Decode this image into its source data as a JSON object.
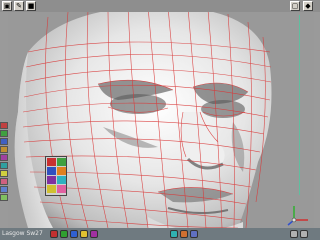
{
  "app": {
    "toolbar": {
      "buttons": [
        "▣",
        "✎",
        "■",
        "▢",
        "◆"
      ]
    },
    "status_bar": {
      "label": "Lasgow Sw27"
    },
    "colors": {
      "viewport_bg": "#999999",
      "wire": "#d93838",
      "axis": "#5fbf9f"
    },
    "icons": {
      "left_tools": [
        "select-icon",
        "move-icon",
        "rotate-icon",
        "scale-icon",
        "brush-icon",
        "sculpt-icon",
        "smooth-icon",
        "color-icon",
        "light-icon",
        "camera-icon"
      ],
      "palette": [
        "brush-red-icon",
        "brush-green-icon",
        "brush-blue-icon",
        "brush-orange-icon",
        "brush-purple-icon",
        "brush-cyan-icon",
        "brush-yellow-icon",
        "brush-pink-icon"
      ],
      "bottom_tools": [
        "render-icon",
        "material-icon",
        "texture-icon",
        "light-icon",
        "camera-icon",
        "grid-icon",
        "snap-icon",
        "layer-icon",
        "undo-icon",
        "redo-icon"
      ]
    }
  }
}
